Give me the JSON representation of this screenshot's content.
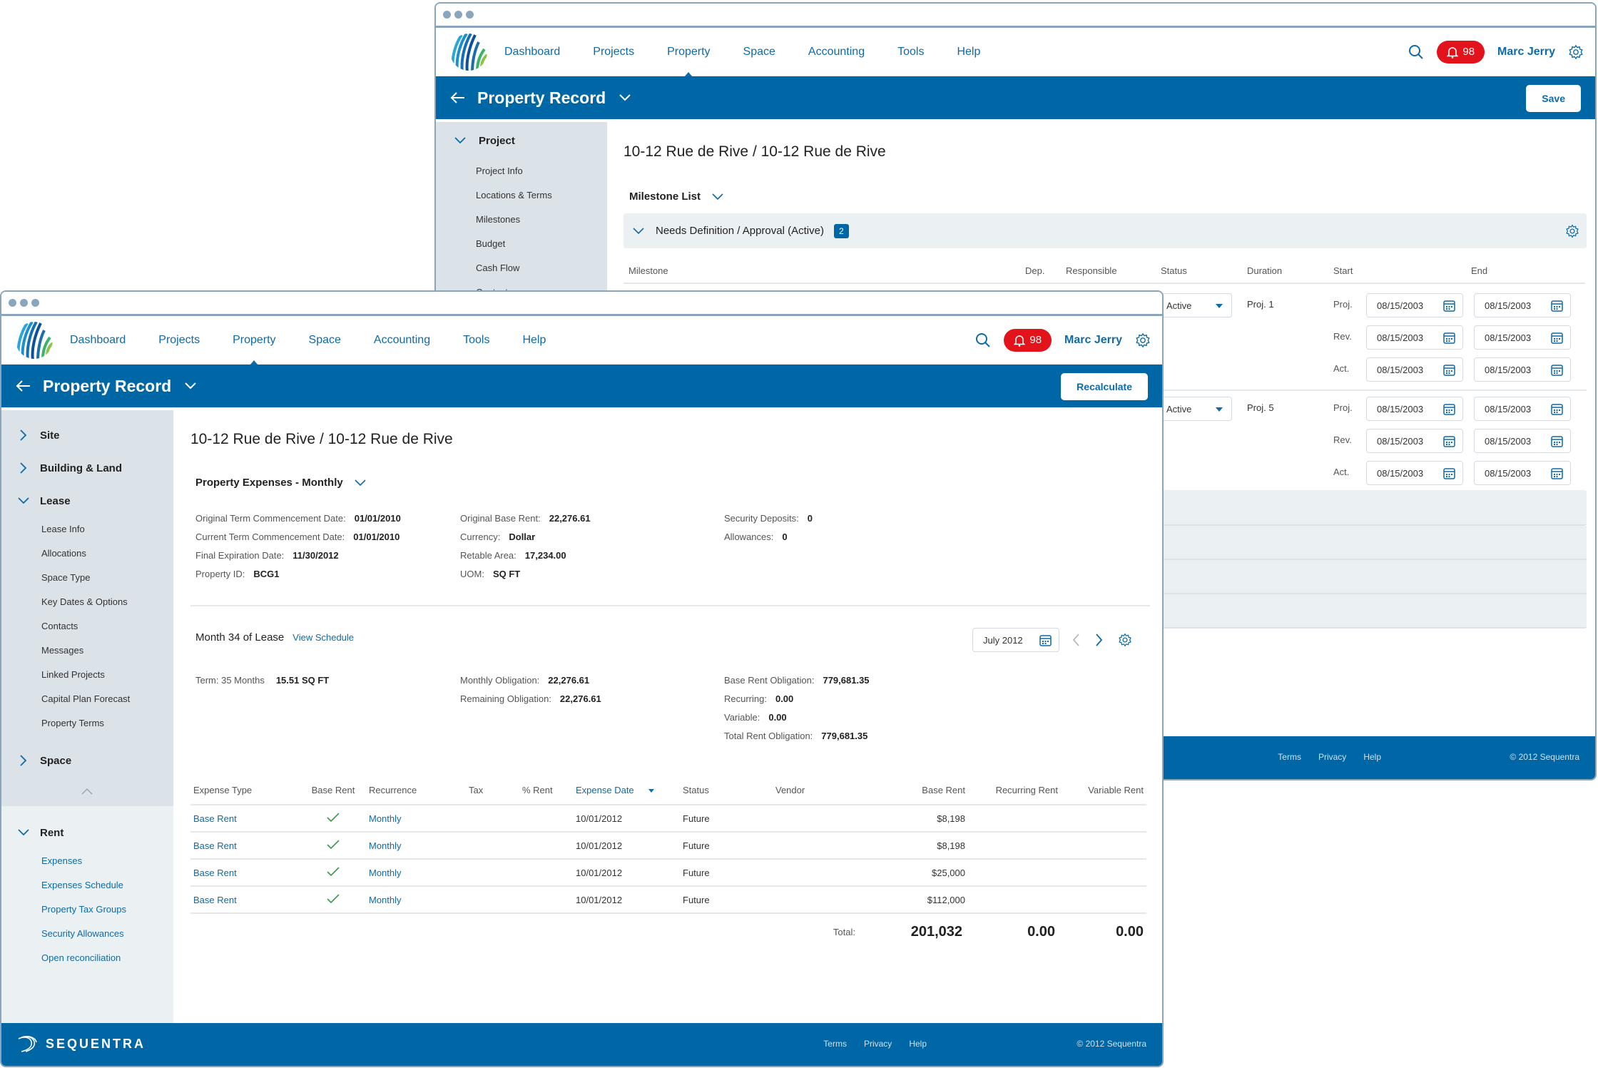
{
  "back_window": {
    "nav": {
      "items": [
        "Dashboard",
        "Projects",
        "Property",
        "Space",
        "Accounting",
        "Tools",
        "Help"
      ],
      "active": "Property",
      "notification_count": "98",
      "user_name": "Marc Jerry"
    },
    "header": {
      "title": "Property Record",
      "button_label": "Save"
    },
    "sidebar": {
      "section": "Project",
      "items": [
        "Project Info",
        "Locations & Terms",
        "Milestones",
        "Budget",
        "Cash Flow",
        "Contacts"
      ]
    },
    "page_title": "10-12 Rue de Rive / 10-12 Rue de Rive",
    "milestone_list_label": "Milestone List",
    "group": {
      "label": "Needs Definition / Approval (Active)",
      "count": "2"
    },
    "columns": [
      "Milestone",
      "Dep.",
      "Responsible",
      "Status",
      "Duration",
      "Start",
      "End"
    ],
    "rows": [
      {
        "status": "Active",
        "duration": "Proj. 1",
        "dates": [
          {
            "type": "Proj.",
            "start": "08/15/2003",
            "end": "08/15/2003"
          },
          {
            "type": "Rev.",
            "start": "08/15/2003",
            "end": "08/15/2003"
          },
          {
            "type": "Act.",
            "start": "08/15/2003",
            "end": "08/15/2003"
          }
        ]
      },
      {
        "status": "Active",
        "duration": "Proj. 5",
        "dates": [
          {
            "type": "Proj.",
            "start": "08/15/2003",
            "end": "08/15/2003"
          },
          {
            "type": "Rev.",
            "start": "08/15/2003",
            "end": "08/15/2003"
          },
          {
            "type": "Act.",
            "start": "08/15/2003",
            "end": "08/15/2003"
          }
        ]
      }
    ],
    "footer": {
      "links": [
        "Terms",
        "Privacy",
        "Help"
      ],
      "copyright": "© 2012 Sequentra"
    }
  },
  "front_window": {
    "nav": {
      "items": [
        "Dashboard",
        "Projects",
        "Property",
        "Space",
        "Accounting",
        "Tools",
        "Help"
      ],
      "active": "Property",
      "notification_count": "98",
      "user_name": "Marc Jerry"
    },
    "header": {
      "title": "Property Record",
      "button_label": "Recalculate"
    },
    "sidebar": {
      "sections_top": [
        "Site",
        "Building & Land"
      ],
      "lease_section": "Lease",
      "lease_items": [
        "Lease Info",
        "Allocations",
        "Space Type",
        "Key Dates & Options",
        "Contacts",
        "Messages",
        "Linked Projects",
        "Capital Plan Forecast",
        "Property Terms"
      ],
      "space_section": "Space",
      "rent_section": "Rent",
      "rent_items": [
        "Expenses",
        "Expenses Schedule",
        "Property Tax Groups",
        "Security Allowances",
        "Open reconciliation"
      ],
      "brand": "SEQUENTRA"
    },
    "page_title": "10-12 Rue de Rive / 10-12 Rue de Rive",
    "expenses_section": {
      "label": "Property Expenses - Monthly",
      "col1": [
        {
          "label": "Original Term Commencement Date:",
          "value": "01/01/2010"
        },
        {
          "label": "Current Term Commencement Date:",
          "value": "01/01/2010"
        },
        {
          "label": "Final Expiration Date:",
          "value": "11/30/2012"
        },
        {
          "label": "Property ID:",
          "value": "BCG1"
        }
      ],
      "col2": [
        {
          "label": "Original Base Rent:",
          "value": "22,276.61"
        },
        {
          "label": "Currency:",
          "value": "Dollar"
        },
        {
          "label": "Retable Area:",
          "value": "17,234.00"
        },
        {
          "label": "UOM:",
          "value": "SQ FT"
        }
      ],
      "col3": [
        {
          "label": "Security Deposits:",
          "value": "0"
        },
        {
          "label": "Allowances:",
          "value": "0"
        }
      ]
    },
    "month_section": {
      "label": "Month 34 of Lease",
      "view_schedule": "View Schedule",
      "month_picker": "July 2012",
      "term_label": "Term: 35 Months",
      "term_value": "15.51 SQ FT",
      "col2": [
        {
          "label": "Monthly Obligation:",
          "value": "22,276.61"
        },
        {
          "label": "Remaining Obligation:",
          "value": "22,276.61"
        }
      ],
      "col3": [
        {
          "label": "Base Rent Obligation:",
          "value": "779,681.35"
        },
        {
          "label": "Recurring:",
          "value": "0.00"
        },
        {
          "label": "Variable:",
          "value": "0.00"
        },
        {
          "label": "Total Rent Obligation:",
          "value": "779,681.35"
        }
      ]
    },
    "expense_table": {
      "columns": [
        "Expense Type",
        "Base Rent",
        "Recurrence",
        "Tax",
        "% Rent",
        "Expense Date",
        "Status",
        "Vendor",
        "Base Rent",
        "Recurring Rent",
        "Variable Rent"
      ],
      "sorted_column": "Expense Date",
      "rows": [
        {
          "type": "Base Rent",
          "base_rent_check": true,
          "recurrence": "Monthly",
          "tax": "",
          "pct_rent": "",
          "date": "10/01/2012",
          "status": "Future",
          "vendor": "",
          "base_rent": "$8,198",
          "recurring": "",
          "variable": ""
        },
        {
          "type": "Base Rent",
          "base_rent_check": true,
          "recurrence": "Monthly",
          "tax": "",
          "pct_rent": "",
          "date": "10/01/2012",
          "status": "Future",
          "vendor": "",
          "base_rent": "$8,198",
          "recurring": "",
          "variable": ""
        },
        {
          "type": "Base Rent",
          "base_rent_check": true,
          "recurrence": "Monthly",
          "tax": "",
          "pct_rent": "",
          "date": "10/01/2012",
          "status": "Future",
          "vendor": "",
          "base_rent": "$25,000",
          "recurring": "",
          "variable": ""
        },
        {
          "type": "Base Rent",
          "base_rent_check": true,
          "recurrence": "Monthly",
          "tax": "",
          "pct_rent": "",
          "date": "10/01/2012",
          "status": "Future",
          "vendor": "",
          "base_rent": "$112,000",
          "recurring": "",
          "variable": ""
        }
      ],
      "total_label": "Total:",
      "total_base_rent": "201,032",
      "total_recurring": "0.00",
      "total_variable": "0.00"
    },
    "footer": {
      "links": [
        "Terms",
        "Privacy",
        "Help"
      ],
      "copyright": "© 2012 Sequentra"
    }
  },
  "colors": {
    "brand_blue": "#0067a6",
    "link_blue": "#0f6aa6",
    "badge_red": "#e3131b",
    "sidebar_bg": "#dbe2e8",
    "check_green": "#3a9a4a"
  }
}
